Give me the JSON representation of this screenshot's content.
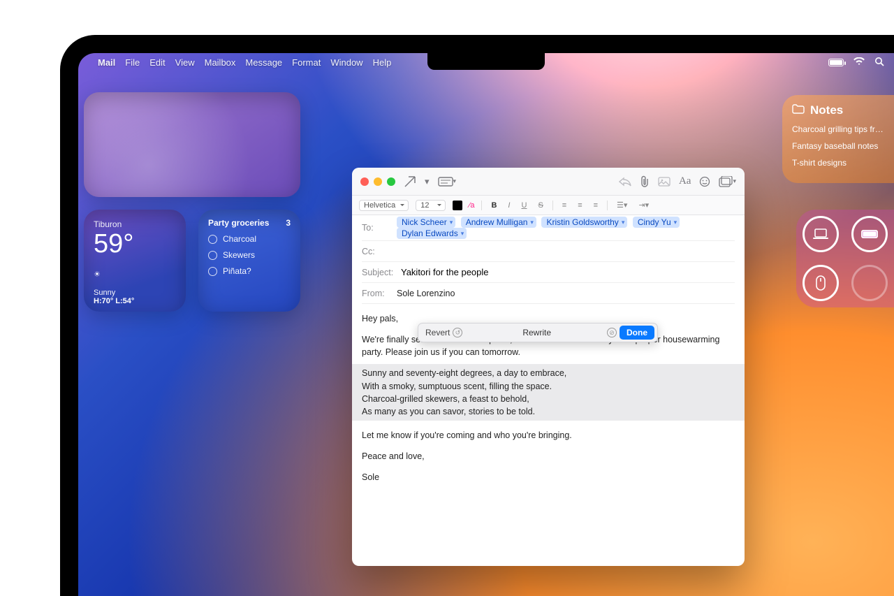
{
  "menubar": {
    "app": "Mail",
    "items": [
      "File",
      "Edit",
      "View",
      "Mailbox",
      "Message",
      "Format",
      "Window",
      "Help"
    ]
  },
  "weather": {
    "location": "Tiburon",
    "temp": "59°",
    "condition": "Sunny",
    "high_low": "H:70° L:54°"
  },
  "reminders": {
    "title": "Party groceries",
    "count": "3",
    "items": [
      "Charcoal",
      "Skewers",
      "Piñata?"
    ]
  },
  "notes": {
    "title": "Notes",
    "items": [
      "Charcoal grilling tips from Sh",
      "Fantasy baseball notes",
      "T-shirt designs"
    ]
  },
  "mail": {
    "font_family": "Helvetica",
    "font_size": "12",
    "to_label": "To:",
    "cc_label": "Cc:",
    "subject_label": "Subject:",
    "from_label": "From:",
    "recipients": [
      "Nick Scheer",
      "Andrew Mulligan",
      "Kristin Goldsworthy",
      "Cindy Yu",
      "Dylan Edwards"
    ],
    "subject_value": "Yakitori for the people",
    "from_value": "Sole Lorenzino",
    "greeting": "Hey pals,",
    "intro": "We're finally settled into the new place, which means we're ready for a proper housewarming party. Please join us if you can tomorrow.",
    "poem": [
      "Sunny and seventy-eight degrees, a day to embrace,",
      "With a smoky, sumptuous scent, filling the space.",
      "Charcoal-grilled skewers, a feast to behold,",
      "As many as you can savor, stories to be told."
    ],
    "rsvp": "Let me know if you're coming and who you're bringing.",
    "signoff": "Peace and love,",
    "name": "Sole"
  },
  "rewrite": {
    "revert": "Revert",
    "title": "Rewrite",
    "done": "Done"
  }
}
